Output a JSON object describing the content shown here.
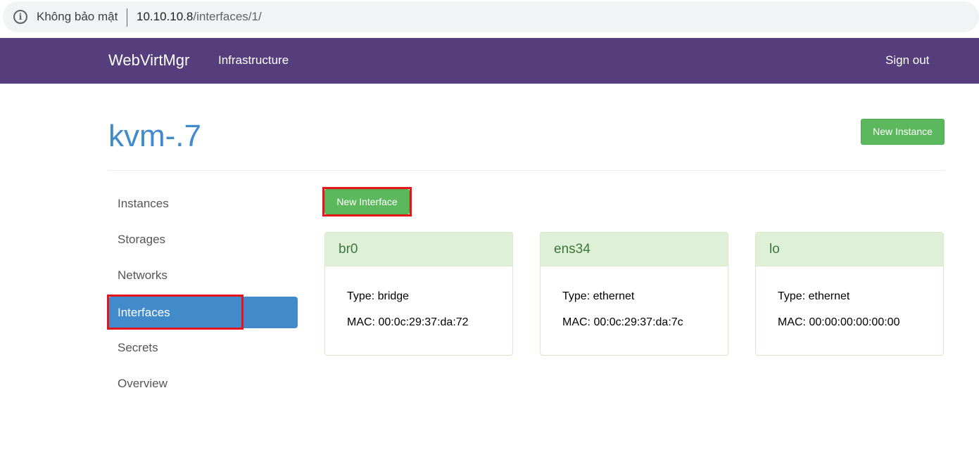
{
  "browser": {
    "security_label": "Không bảo mật",
    "url_host": "10.10.10.8",
    "url_path": "/interfaces/1/",
    "info_icon": "info-icon"
  },
  "navbar": {
    "brand": "WebVirtMgr",
    "infrastructure": "Infrastructure",
    "sign_out": "Sign out"
  },
  "header": {
    "title": "kvm-.7",
    "new_instance": "New Instance"
  },
  "sidebar": {
    "items": [
      {
        "label": "Instances"
      },
      {
        "label": "Storages"
      },
      {
        "label": "Networks"
      },
      {
        "label": "Interfaces"
      },
      {
        "label": "Secrets"
      },
      {
        "label": "Overview"
      }
    ],
    "active": "Interfaces"
  },
  "main": {
    "new_interface": "New Interface",
    "type_prefix": "Type:",
    "mac_prefix": "MAC:",
    "interfaces": [
      {
        "name": "br0",
        "type": "bridge",
        "mac": "00:0c:29:37:da:72"
      },
      {
        "name": "ens34",
        "type": "ethernet",
        "mac": "00:0c:29:37:da:7c"
      },
      {
        "name": "lo",
        "type": "ethernet",
        "mac": "00:00:00:00:00:00"
      }
    ]
  },
  "colors": {
    "navbar": "#563d7c",
    "accent": "#428bca",
    "success": "#5cb85c",
    "panel_heading": "#dff0d8",
    "highlight": "#e8141b"
  }
}
